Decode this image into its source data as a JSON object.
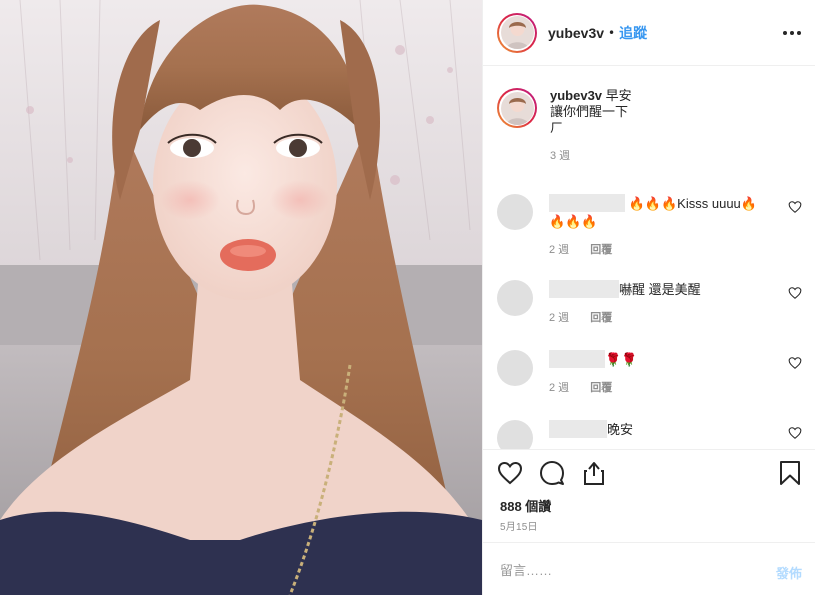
{
  "post": {
    "username": "yubev3v",
    "separator": "•",
    "follow_label": "追蹤",
    "caption_lines": [
      "早安",
      "讓你們醒一下",
      "ㄏ"
    ],
    "caption_age": "3 週"
  },
  "comments": [
    {
      "text": "🔥🔥🔥Kisss uuuu🔥",
      "text2": "🔥🔥🔥",
      "age": "2 週",
      "reply": "回覆"
    },
    {
      "text": "嚇醒 還是美醒",
      "age": "2 週",
      "reply": "回覆"
    },
    {
      "text": "🌹🌹",
      "age": "2 週",
      "reply": "回覆"
    },
    {
      "text": "晚安",
      "age": "",
      "reply": ""
    }
  ],
  "actions": {
    "views": "888 個讚",
    "date": "5月15日"
  },
  "comment_box": {
    "placeholder": "留言……",
    "post_label": "發佈"
  },
  "icons": {
    "more": "more-options-icon",
    "like": "heart-icon",
    "comment": "comment-bubble-icon",
    "share": "share-icon",
    "save": "bookmark-icon"
  },
  "colors": {
    "accent": "#3897f0",
    "post_disabled": "#b3dbff",
    "meta": "#8e8e8e"
  }
}
